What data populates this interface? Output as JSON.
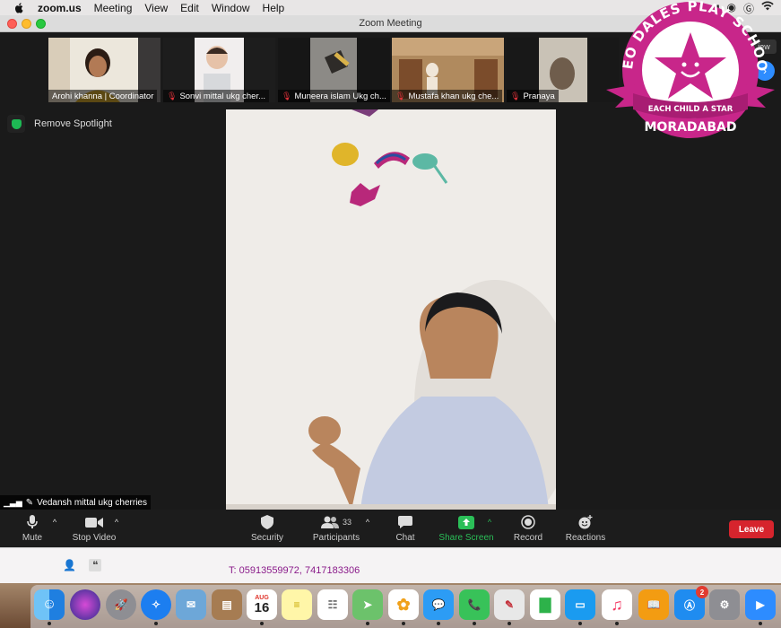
{
  "menubar": {
    "app": "zoom.us",
    "items": [
      "Meeting",
      "View",
      "Edit",
      "Window",
      "Help"
    ]
  },
  "window": {
    "title": "Zoom Meeting"
  },
  "participants": [
    {
      "name": "Arohi khanna | Coordinator",
      "muted": false
    },
    {
      "name": "Sonvi mittal  ukg cher...",
      "muted": true
    },
    {
      "name": "Muneera islam Ukg ch...",
      "muted": true
    },
    {
      "name": "Mustafa khan ukg che...",
      "muted": true
    },
    {
      "name": "Pranaya",
      "muted": true
    }
  ],
  "spotlight": {
    "remove_label": "Remove Spotlight"
  },
  "speaker": {
    "name": "Vedansh mittal ukg cherries"
  },
  "badge": {
    "top_text": "NEO DALES PLAY SCHOOL",
    "ribbon_text": "EACH CHILD A STAR",
    "bottom_text": "MORADABAD",
    "view_fragment": "iew"
  },
  "toolbar": {
    "mute": "Mute",
    "stop_video": "Stop Video",
    "security": "Security",
    "participants": "Participants",
    "participants_count": "33",
    "chat": "Chat",
    "share_screen": "Share Screen",
    "record": "Record",
    "reactions": "Reactions",
    "leave": "Leave"
  },
  "doc": {
    "phone": "T:   05913559972, 7417183306"
  },
  "dock": {
    "calendar_month": "AUG",
    "calendar_day": "16",
    "appstore_badge": "2"
  },
  "colors": {
    "accent_green": "#2bbf58",
    "leave_red": "#d6242d",
    "badge_magenta": "#c8268a"
  }
}
